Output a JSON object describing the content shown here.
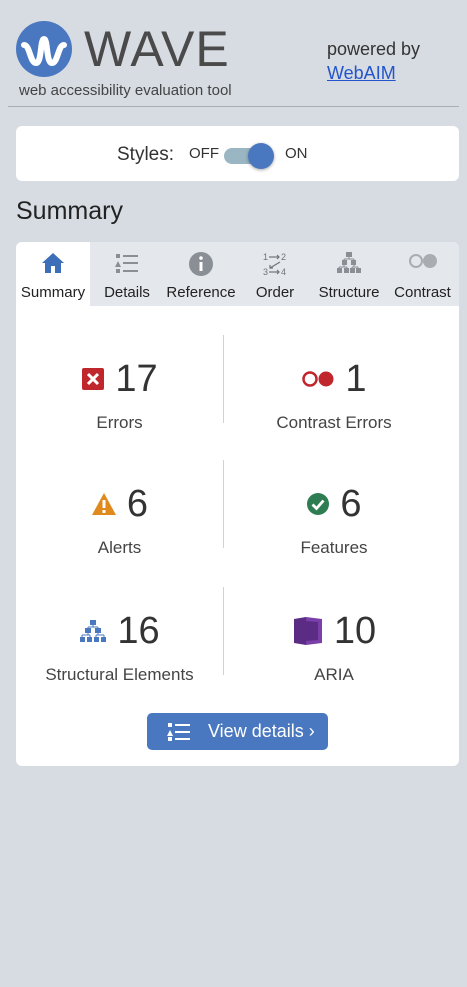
{
  "header": {
    "app_name": "WAVE",
    "tagline": "web accessibility evaluation tool",
    "powered_by": "powered by",
    "webaim_link": "WebAIM",
    "brand_color": "#4a78c0"
  },
  "styles_toggle": {
    "label": "Styles:",
    "off_label": "OFF",
    "on_label": "ON",
    "state": "on"
  },
  "section_title": "Summary",
  "tabs": [
    {
      "label": "Summary",
      "icon": "home-icon",
      "active": true
    },
    {
      "label": "Details",
      "icon": "details-list-icon",
      "active": false
    },
    {
      "label": "Reference",
      "icon": "info-icon",
      "active": false
    },
    {
      "label": "Order",
      "icon": "order-icon",
      "active": false
    },
    {
      "label": "Structure",
      "icon": "structure-icon",
      "active": false
    },
    {
      "label": "Contrast",
      "icon": "contrast-icon",
      "active": false
    }
  ],
  "stats": [
    {
      "label": "Errors",
      "value": "17",
      "icon": "error-icon",
      "color": "#c0272d"
    },
    {
      "label": "Contrast Errors",
      "value": "1",
      "icon": "contrast-error-icon",
      "color": "#c0272d"
    },
    {
      "label": "Alerts",
      "value": "6",
      "icon": "alert-icon",
      "color": "#e08a1e"
    },
    {
      "label": "Features",
      "value": "6",
      "icon": "feature-icon",
      "color": "#2e7d52"
    },
    {
      "label": "Structural Elements",
      "value": "16",
      "icon": "structural-icon",
      "color": "#4a78c0"
    },
    {
      "label": "ARIA",
      "value": "10",
      "icon": "aria-icon",
      "color": "#5b2c83"
    }
  ],
  "view_details_button": {
    "label": "View details ›",
    "icon": "details-list-icon"
  }
}
